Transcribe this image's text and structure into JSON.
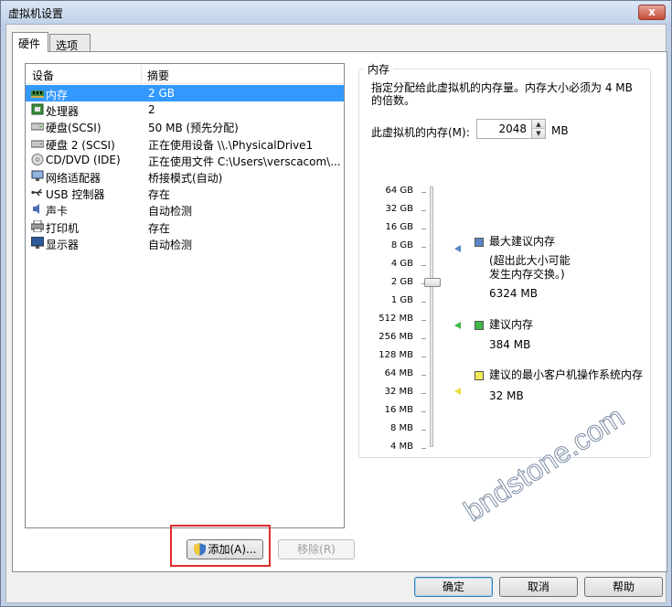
{
  "window": {
    "title": "虚拟机设置",
    "close_label": "x"
  },
  "tabs": [
    {
      "label": "硬件"
    },
    {
      "label": "选项"
    }
  ],
  "device_list": {
    "headers": {
      "device": "设备",
      "summary": "摘要"
    },
    "rows": [
      {
        "name": "内存",
        "summary": "2 GB",
        "icon": "memory-icon",
        "selected": true
      },
      {
        "name": "处理器",
        "summary": "2",
        "icon": "processor-icon"
      },
      {
        "name": "硬盘(SCSI)",
        "summary": "50 MB (预先分配)",
        "icon": "hard-disk-icon"
      },
      {
        "name": "硬盘 2 (SCSI)",
        "summary": "正在使用设备 \\\\.\\PhysicalDrive1",
        "icon": "hard-disk-icon"
      },
      {
        "name": "CD/DVD (IDE)",
        "summary": "正在使用文件 C:\\Users\\verscacom\\...",
        "icon": "cd-dvd-icon"
      },
      {
        "name": "网络适配器",
        "summary": "桥接模式(自动)",
        "icon": "network-adapter-icon"
      },
      {
        "name": "USB 控制器",
        "summary": "存在",
        "icon": "usb-icon"
      },
      {
        "name": "声卡",
        "summary": "自动检测",
        "icon": "sound-card-icon"
      },
      {
        "name": "打印机",
        "summary": "存在",
        "icon": "printer-icon"
      },
      {
        "name": "显示器",
        "summary": "自动检测",
        "icon": "display-icon"
      }
    ]
  },
  "buttons": {
    "add": "添加(A)...",
    "remove": "移除(R)",
    "ok": "确定",
    "cancel": "取消",
    "help": "帮助"
  },
  "memory_panel": {
    "title": "内存",
    "description": "指定分配给此虚拟机的内存量。内存大小必须为 4 MB 的倍数。",
    "memory_label": "此虚拟机的内存(M):",
    "memory_value": "2048",
    "memory_unit": "MB",
    "scale_labels": [
      "64 GB",
      "32 GB",
      "16 GB",
      "8 GB",
      "4 GB",
      "2 GB",
      "1 GB",
      "512 MB",
      "256 MB",
      "128 MB",
      "64 MB",
      "32 MB",
      "16 MB",
      "8 MB",
      "4 MB"
    ],
    "slider_value_mb": 2048,
    "legend": {
      "max": {
        "title": "最大建议内存",
        "note_line1": "(超出此大小可能",
        "note_line2": "发生内存交换。)",
        "value": "6324 MB",
        "color": "#5b86c6"
      },
      "recommended": {
        "title": "建议内存",
        "value": "384 MB",
        "color": "#3fb94a"
      },
      "min_guest": {
        "title": "建议的最小客户机操作系统内存",
        "value": "32 MB",
        "color": "#f3ea59"
      }
    }
  },
  "watermark": "bndstone.com",
  "colors": {
    "selection": "#3399ff",
    "highlight_box": "#e32b2b"
  }
}
